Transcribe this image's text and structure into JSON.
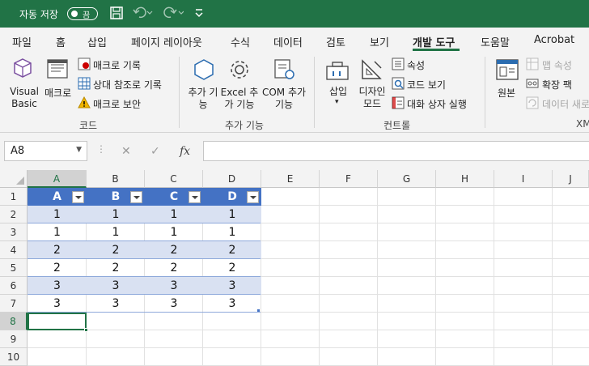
{
  "titlebar": {
    "autosave_label": "자동 저장",
    "autosave_state": "끔",
    "save_icon": "save-icon",
    "undo_icon": "undo-icon",
    "redo_icon": "redo-icon",
    "customize_icon": "customize-qat-icon"
  },
  "ribbon_tabs": [
    "파일",
    "홈",
    "삽입",
    "페이지 레이아웃",
    "수식",
    "데이터",
    "검토",
    "보기",
    "개발 도구",
    "도움말",
    "Acrobat"
  ],
  "active_tab": "개발 도구",
  "ribbon": {
    "code": {
      "visual_basic": "Visual Basic",
      "macros": "매크로",
      "record_macro": "매크로 기록",
      "relative_refs": "상대 참조로 기록",
      "macro_security": "매크로 보안",
      "label": "코드"
    },
    "addins": {
      "addins": "추가 기능",
      "excel_addins": "Excel 추가 기능",
      "com_addins": "COM 추가 기능",
      "label": "추가 기능"
    },
    "controls": {
      "insert": "삽입",
      "design_mode": "디자인 모드",
      "properties": "속성",
      "view_code": "코드 보기",
      "run_dialog": "대화 상자 실행",
      "label": "컨트롤"
    },
    "xml": {
      "source": "원본",
      "map_properties": "맵 속성",
      "expansion_packs": "확장 팩",
      "refresh_data": "데이터 새로",
      "label": "XM"
    }
  },
  "formula_bar": {
    "name_box": "A8",
    "cancel_icon": "✕",
    "enter_icon": "✓",
    "fx_icon": "fx",
    "formula": ""
  },
  "sheet": {
    "columns": [
      "A",
      "B",
      "C",
      "D",
      "E",
      "F",
      "G",
      "H",
      "I",
      "J"
    ],
    "rows": [
      "1",
      "2",
      "3",
      "4",
      "5",
      "6",
      "7",
      "8",
      "9",
      "10"
    ],
    "table_headers": [
      "A",
      "B",
      "C",
      "D"
    ],
    "table_rows": [
      [
        "1",
        "1",
        "1",
        "1"
      ],
      [
        "1",
        "1",
        "1",
        "1"
      ],
      [
        "2",
        "2",
        "2",
        "2"
      ],
      [
        "2",
        "2",
        "2",
        "2"
      ],
      [
        "3",
        "3",
        "3",
        "3"
      ],
      [
        "3",
        "3",
        "3",
        "3"
      ]
    ],
    "active_cell": "A8",
    "colors": {
      "header": "#4472c4",
      "band": "#d9e1f2",
      "accent": "#217346"
    }
  }
}
